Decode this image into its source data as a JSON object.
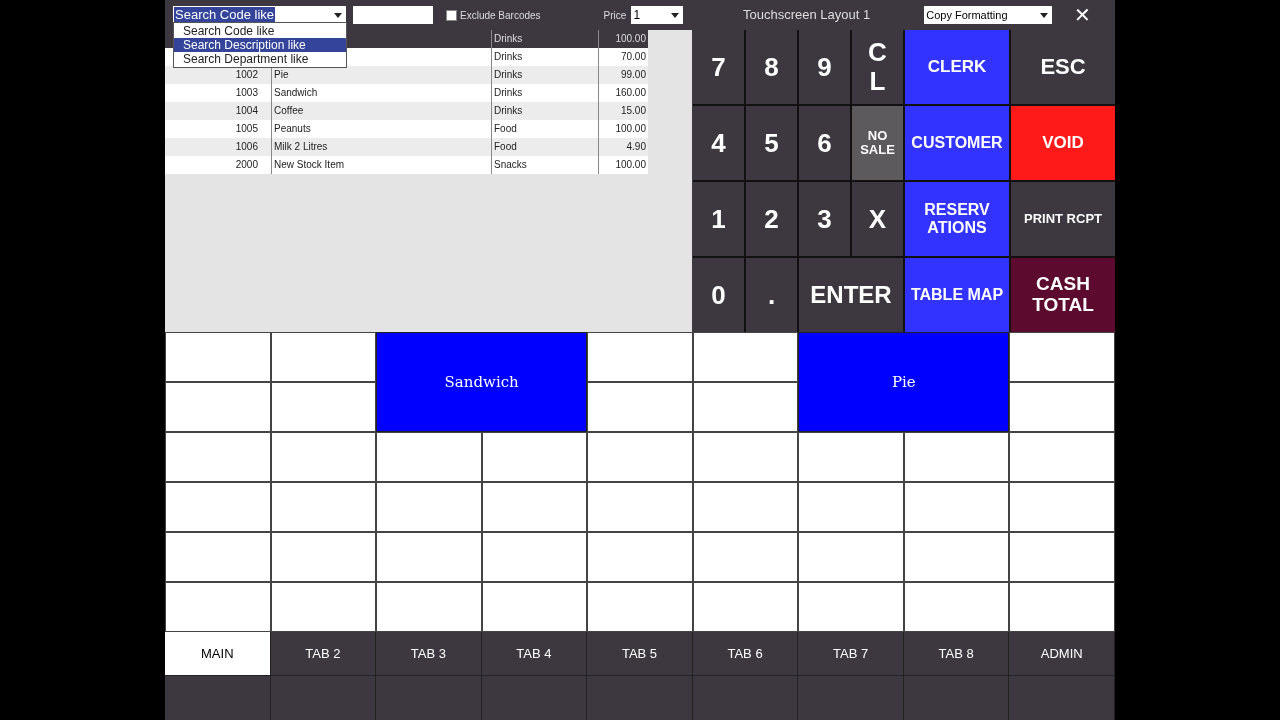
{
  "toolbar": {
    "search_mode": "Search Code like",
    "search_options": [
      {
        "label": "Search Code like",
        "selected": false
      },
      {
        "label": "Search Description like",
        "selected": true
      },
      {
        "label": "Search Department like",
        "selected": false
      }
    ],
    "exclude_barcodes": {
      "label": "Exclude Barcodes",
      "checked": false
    },
    "price_label": "Price",
    "price_level": "1",
    "title": "Touchscreen Layout 1",
    "copy_formatting": "Copy Formatting",
    "close": "✕"
  },
  "items": [
    {
      "department": "Drinks",
      "price": "100.00",
      "selected": true
    },
    {
      "department": "Drinks",
      "price": "70.00",
      "selected": false
    },
    {
      "code": "1002",
      "description": "Pie",
      "department": "Drinks",
      "price": "99.00",
      "selected": false
    },
    {
      "code": "1003",
      "description": "Sandwich",
      "department": "Drinks",
      "price": "160.00",
      "selected": false
    },
    {
      "code": "1004",
      "description": "Coffee",
      "department": "Drinks",
      "price": "15.00",
      "selected": false
    },
    {
      "code": "1005",
      "description": "Peanuts",
      "department": "Food",
      "price": "100.00",
      "selected": false
    },
    {
      "code": "1006",
      "description": "Milk 2 Litres",
      "department": "Food",
      "price": "4.90",
      "selected": false
    },
    {
      "code": "2000",
      "description": "New Stock Item",
      "department": "Snacks",
      "price": "100.00",
      "selected": false
    }
  ],
  "keypad": [
    {
      "label": "7",
      "color": "#3d383f"
    },
    {
      "label": "8",
      "color": "#3d383f"
    },
    {
      "label": "9",
      "color": "#3d383f"
    },
    {
      "label": "C L",
      "color": "#3d383f"
    },
    {
      "label": "CLERK",
      "color": "#3333ff"
    },
    {
      "label": "ESC",
      "color": "#3d383f"
    },
    {
      "label": "4",
      "color": "#3d383f"
    },
    {
      "label": "5",
      "color": "#3d383f"
    },
    {
      "label": "6",
      "color": "#3d383f"
    },
    {
      "label": "NO SALE",
      "color": "#5c5a5c"
    },
    {
      "label": "CUSTOMER",
      "color": "#3333ff"
    },
    {
      "label": "VOID",
      "color": "#ff1a1a"
    },
    {
      "label": "1",
      "color": "#3d383f"
    },
    {
      "label": "2",
      "color": "#3d383f"
    },
    {
      "label": "3",
      "color": "#3d383f"
    },
    {
      "label": "X",
      "color": "#3d383f"
    },
    {
      "label": "RESERV ATIONS",
      "color": "#3333ff"
    },
    {
      "label": "PRINT RCPT",
      "color": "#3d383f"
    },
    {
      "label": "0",
      "color": "#3d383f"
    },
    {
      "label": ".",
      "color": "#3d383f"
    },
    {
      "label": "ENTER",
      "color": "#3d383f"
    },
    {
      "label": "TABLE MAP",
      "color": "#3333ff"
    },
    {
      "label": "CASH TOTAL",
      "color": "#5c0a2e"
    }
  ],
  "buttons": [
    {
      "label": "Sandwich",
      "color": "#0000ff"
    },
    {
      "label": "Pie",
      "color": "#0000ff"
    }
  ],
  "tabs": [
    {
      "label": "MAIN",
      "selected": true
    },
    {
      "label": "TAB 2",
      "selected": false
    },
    {
      "label": "TAB 3",
      "selected": false
    },
    {
      "label": "TAB 4",
      "selected": false
    },
    {
      "label": "TAB 5",
      "selected": false
    },
    {
      "label": "TAB 6",
      "selected": false
    },
    {
      "label": "TAB 7",
      "selected": false
    },
    {
      "label": "TAB 8",
      "selected": false
    },
    {
      "label": "ADMIN",
      "selected": false
    }
  ]
}
